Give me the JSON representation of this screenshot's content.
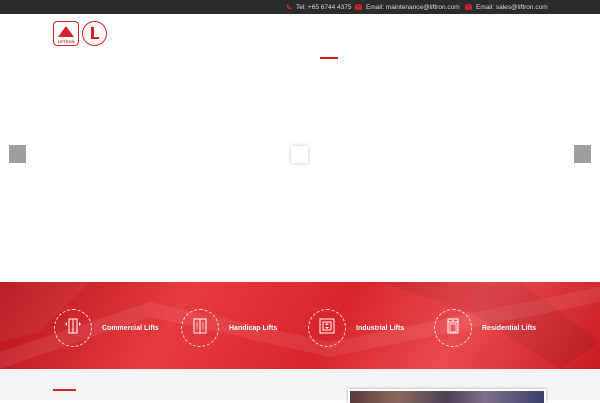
{
  "topbar": {
    "phone": "Tel: +65 6744 4375",
    "email_maintenance": "Email: maintenance@liftron.com",
    "email_sales": "Email: sales@liftron.com"
  },
  "logo": {
    "text": "LIFTRON"
  },
  "services": [
    {
      "label": "Commercial Lifts",
      "icon": "commercial-lift-icon"
    },
    {
      "label": "Handicap Lifts",
      "icon": "handicap-lift-icon"
    },
    {
      "label": "Industrial Lifts",
      "icon": "industrial-lift-icon"
    },
    {
      "label": "Residential Lifts",
      "icon": "residential-lift-icon"
    }
  ],
  "colors": {
    "accent": "#d62128",
    "topbar": "#2b2b2b",
    "arrows": "#9e9e9e"
  }
}
